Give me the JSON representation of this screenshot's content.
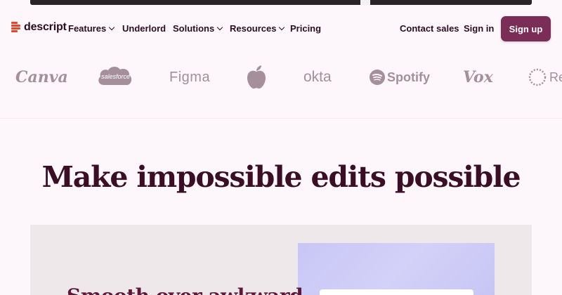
{
  "brand": {
    "name": "descript",
    "accent_color": "#e2462c"
  },
  "nav": {
    "items": [
      {
        "label": "Features",
        "has_dropdown": true
      },
      {
        "label": "Underlord",
        "has_dropdown": false
      },
      {
        "label": "Solutions",
        "has_dropdown": true
      },
      {
        "label": "Resources",
        "has_dropdown": true
      },
      {
        "label": "Pricing",
        "has_dropdown": false
      }
    ],
    "contact_sales": "Contact sales",
    "sign_in": "Sign in",
    "sign_up": "Sign up",
    "sign_up_color": "#7a2d56"
  },
  "customer_logos": [
    "Canva",
    "salesforce",
    "Figma",
    "apple-logo",
    "okta",
    "Spotify",
    "Vox",
    "Re"
  ],
  "hero": {
    "headline": "Make impossible edits possible",
    "subheadline": "Smooth over awkward"
  },
  "colors": {
    "background": "#fdf6fb",
    "text": "#2b0d1e",
    "logo_gray": "#a48f9b"
  }
}
